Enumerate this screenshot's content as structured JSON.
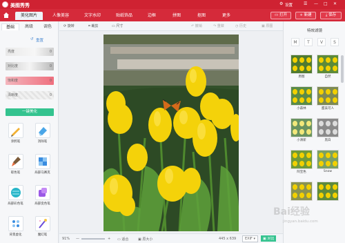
{
  "app": {
    "title": "美图秀秀",
    "settings": "设置"
  },
  "nav": {
    "tabs": [
      "美化图片",
      "人像美容",
      "文字水印",
      "贴纸饰品",
      "边框",
      "拼图",
      "抠图",
      "更多"
    ],
    "open": "打开",
    "new": "新建",
    "save": "保存"
  },
  "left": {
    "tabs": [
      "基础",
      "高级",
      "调色"
    ],
    "reset": "重置",
    "sliders": [
      {
        "label": "亮度",
        "value": "0"
      },
      {
        "label": "对比度",
        "value": "0"
      },
      {
        "label": "饱和度",
        "value": "0"
      },
      {
        "label": "清晰度",
        "value": "0"
      }
    ],
    "one_click": "一键美化",
    "tools": [
      {
        "label": "涂鸦笔",
        "icon": "pencil-icon"
      },
      {
        "label": "消除笔",
        "icon": "eraser-icon"
      },
      {
        "label": "取色笔",
        "icon": "brush-icon"
      },
      {
        "label": "局部马赛克",
        "icon": "mosaic-icon"
      },
      {
        "label": "局部彩色笔",
        "icon": "color-ball-icon"
      },
      {
        "label": "局部变色笔",
        "icon": "color-change-icon"
      },
      {
        "label": "背景虚化",
        "icon": "blur-icon"
      },
      {
        "label": "魔幻笔",
        "icon": "magic-pen-icon"
      }
    ]
  },
  "toolbar": {
    "rotate": "旋转",
    "crop": "裁剪",
    "size": "尺寸",
    "undo": "撤销",
    "redo": "重做",
    "history": "历史",
    "original": "原图"
  },
  "bottom": {
    "zoom": "91%",
    "fit": "适合",
    "original": "原大小",
    "dimensions": "445 x 639",
    "exif": "EXIF",
    "compare": "对比"
  },
  "right": {
    "title": "特效滤镜",
    "tabs": [
      "M",
      "T",
      "V",
      "S"
    ],
    "filters": [
      "原图",
      "自然",
      "小森林",
      "甜美可人",
      "小清新",
      "黑白",
      "阿宝色",
      "Snow",
      "",
      ""
    ]
  },
  "watermark": {
    "text": "Bai经验",
    "sub": "jingyan.baidu.com"
  }
}
